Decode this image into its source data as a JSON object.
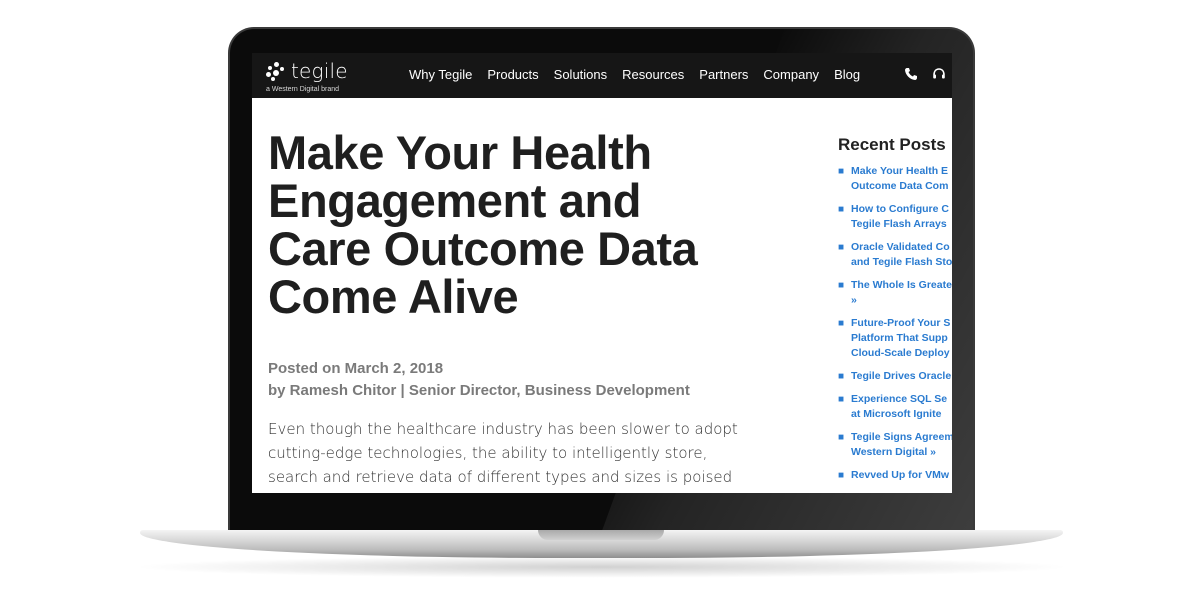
{
  "header": {
    "logo_text": "tegile",
    "logo_tagline": "a Western Digital brand",
    "nav": [
      "Why Tegile",
      "Products",
      "Solutions",
      "Resources",
      "Partners",
      "Company",
      "Blog"
    ],
    "icons": [
      "phone-icon",
      "headset-icon"
    ]
  },
  "article": {
    "title": "Make Your Health Engagement and Care Outcome Data Come Alive",
    "posted": "Posted on March 2, 2018",
    "author": "by Ramesh Chitor | Senior Director, Business Development",
    "body": "Even though the healthcare industry has been slower to adopt cutting-edge technologies, the ability to intelligently store, search and retrieve data of different types and sizes is poised to transform how we keep people safer"
  },
  "sidebar": {
    "title": "Recent Posts",
    "posts": [
      {
        "lines": [
          "Make Your Health E",
          "Outcome Data Com"
        ]
      },
      {
        "lines": [
          "How to Configure C",
          "Tegile Flash Arrays"
        ]
      },
      {
        "lines": [
          "Oracle Validated Co",
          "and Tegile Flash Sto"
        ]
      },
      {
        "lines": [
          "The Whole Is Greate",
          "»"
        ]
      },
      {
        "lines": [
          "Future-Proof Your S",
          "Platform That Supp",
          "Cloud-Scale Deploy"
        ]
      },
      {
        "lines": [
          "Tegile Drives Oracle"
        ]
      },
      {
        "lines": [
          "Experience SQL Se",
          "at Microsoft Ignite"
        ]
      },
      {
        "lines": [
          "Tegile Signs Agreem",
          "Western Digital »"
        ]
      },
      {
        "lines": [
          "Revved Up for VMw"
        ]
      }
    ]
  },
  "colors": {
    "header_bg": "#161616",
    "link": "#2a7bd0",
    "title": "#1f1f1f",
    "meta": "#7a7a7a"
  }
}
